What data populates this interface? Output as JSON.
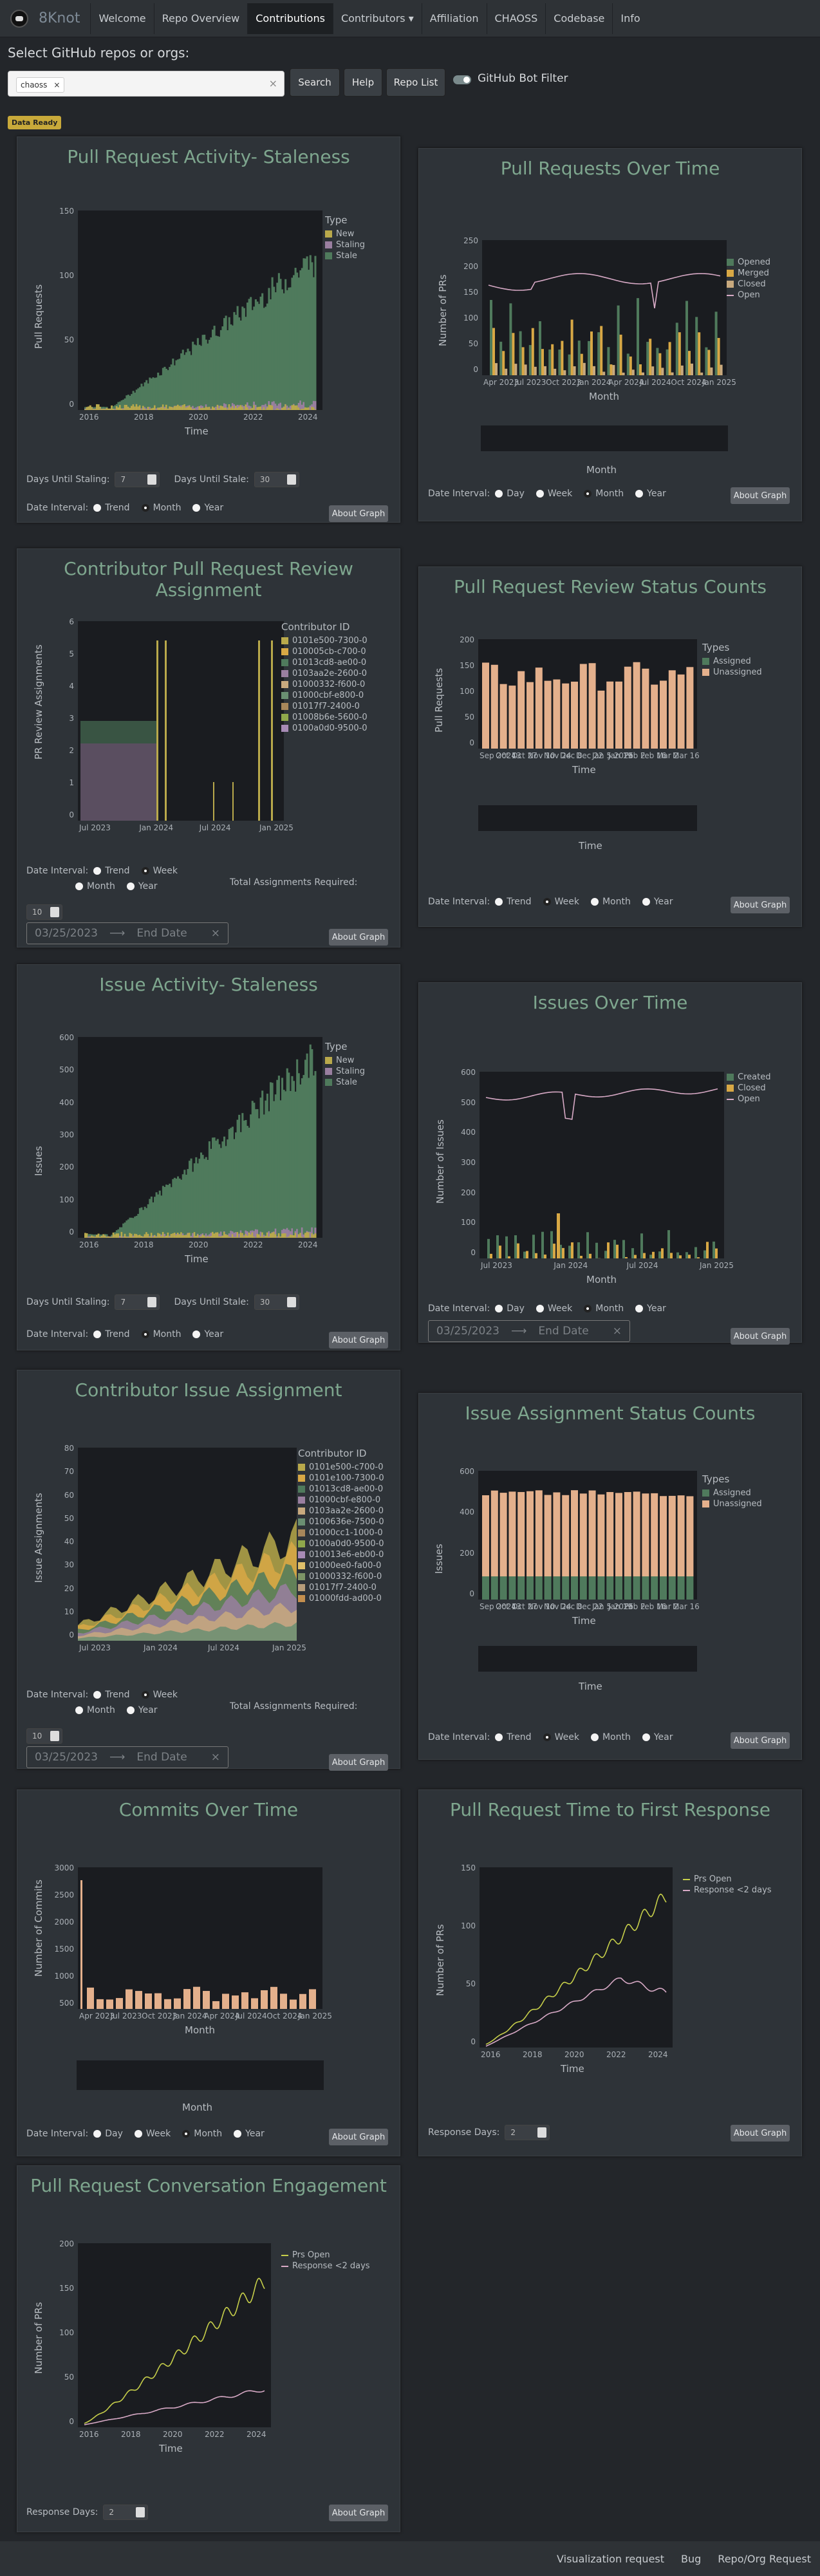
{
  "nav": {
    "brand": "8Knot",
    "items": [
      "Welcome",
      "Repo Overview",
      "Contributions",
      "Contributors ▾",
      "Affiliation",
      "CHAOSS",
      "Codebase",
      "Info"
    ],
    "active": "Contributions"
  },
  "search": {
    "label": "Select GitHub repos or orgs:",
    "chip": "chaoss",
    "search_btn": "Search",
    "help_btn": "Help",
    "repo_list_btn": "Repo List",
    "bot_filter": "GitHub Bot Filter"
  },
  "badge": "Data Ready",
  "common": {
    "about": "About Graph",
    "date_interval": "Date Interval:",
    "trend": "Trend",
    "month": "Month",
    "year": "Year",
    "week": "Week",
    "day": "Day",
    "stal": "Days Until Staling:",
    "stale": "Days Until Stale:",
    "stal_val": "7",
    "stale_val": "30",
    "types": "Types",
    "type": "Type",
    "start_date": "03/25/2023",
    "end_date": "End Date",
    "total_assign": "Total Assignments Required:",
    "total_val": "10",
    "resp_days": "Response Days:",
    "resp_val": "2",
    "contrib_id": "Contributor ID"
  },
  "cards": {
    "pr_stale": {
      "title": "Pull Request Activity- Staleness",
      "ylabel": "Pull Requests",
      "xlabel": "Time",
      "legend": [
        "New",
        "Staling",
        "Stale"
      ],
      "yticks": [
        "150",
        "100",
        "50",
        "0"
      ],
      "xticks": [
        "2016",
        "2018",
        "2020",
        "2022",
        "2024"
      ]
    },
    "pr_time": {
      "title": "Pull Requests Over Time",
      "ylabel": "Number of PRs",
      "xlabel": "Month",
      "legend": [
        "Opened",
        "Merged",
        "Closed",
        "Open"
      ],
      "yticks": [
        "250",
        "200",
        "150",
        "100",
        "50",
        "0"
      ],
      "xticks": [
        "Apr 2023",
        "Jul 2023",
        "Oct 2023",
        "Jan 2024",
        "Apr 2024",
        "Jul 2024",
        "Oct 2024",
        "Jan 2025"
      ]
    },
    "contrib_pr": {
      "title": "Contributor Pull Request Review Assignment",
      "ylabel": "PR Review Assignments",
      "legend": [
        "0101e500-7300-0",
        "010005cb-c700-0",
        "01013cd8-ae00-0",
        "0103aa2e-2600-0",
        "01000332-f600-0",
        "01000cbf-e800-0",
        "01017f7-2400-0",
        "01008b6e-5600-0",
        "0100a0d0-9500-0"
      ],
      "yticks": [
        "6",
        "5",
        "4",
        "3",
        "2",
        "1",
        "0"
      ],
      "xticks": [
        "Jul 2023",
        "Jan 2024",
        "Jul 2024",
        "Jan 2025"
      ]
    },
    "pr_review": {
      "title": "Pull Request Review Status Counts",
      "ylabel": "Pull Requests",
      "xlabel": "Time",
      "legend": [
        "Assigned",
        "Unassigned"
      ],
      "yticks": [
        "200",
        "150",
        "100",
        "50",
        "0"
      ],
      "xticks": [
        "Sep 2024",
        "Oct 13",
        "Oct 27",
        "Nov 10",
        "Nov 24",
        "Dec 8",
        "Dec 22",
        "Jan 5 2025",
        "Jan 19",
        "Feb 2",
        "Feb 16",
        "Mar 2",
        "Mar 16"
      ]
    },
    "issue_stale": {
      "title": "Issue Activity- Staleness",
      "ylabel": "Issues",
      "xlabel": "Time",
      "legend": [
        "New",
        "Staling",
        "Stale"
      ],
      "yticks": [
        "600",
        "500",
        "400",
        "300",
        "200",
        "100",
        "0"
      ],
      "xticks": [
        "2016",
        "2018",
        "2020",
        "2022",
        "2024"
      ]
    },
    "issue_time": {
      "title": "Issues Over Time",
      "ylabel": "Number of Issues",
      "xlabel": "Month",
      "legend": [
        "Created",
        "Closed",
        "Open"
      ],
      "yticks": [
        "600",
        "500",
        "400",
        "300",
        "200",
        "100",
        "0"
      ],
      "xticks": [
        "Jul 2023",
        "Jan 2024",
        "Jul 2024",
        "Jan 2025"
      ]
    },
    "contrib_issue": {
      "title": "Contributor Issue Assignment",
      "ylabel": "Issue Assignments",
      "legend": [
        "0101e500-c700-0",
        "0101e100-7300-0",
        "01013cd8-ae00-0",
        "01000cbf-e800-0",
        "0103aa2e-2600-0",
        "0100636e-7500-0",
        "01000cc1-1000-0",
        "0100a0d0-9500-0",
        "010013e6-eb00-0",
        "01000ee0-fa00-0",
        "01000332-f600-0",
        "01017f7-2400-0",
        "01000fdd-ad00-0"
      ],
      "yticks": [
        "80",
        "70",
        "60",
        "50",
        "40",
        "30",
        "20",
        "10",
        "0"
      ],
      "xticks": [
        "Jul 2023",
        "Jan 2024",
        "Jul 2024",
        "Jan 2025"
      ]
    },
    "issue_assign": {
      "title": "Issue Assignment Status Counts",
      "ylabel": "Issues",
      "xlabel": "Time",
      "legend": [
        "Assigned",
        "Unassigned"
      ],
      "yticks": [
        "600",
        "400",
        "200",
        "0"
      ],
      "xticks": [
        "Sep 2024",
        "Oct 13",
        "Oct 27",
        "Nov 10",
        "Nov 24",
        "Dec 8",
        "Dec 22",
        "Jan 5 2025",
        "Jan 19",
        "Feb 2",
        "Feb 16",
        "Mar 2",
        "Mar 16"
      ]
    },
    "commits": {
      "title": "Commits Over Time",
      "ylabel": "Number of Commits",
      "xlabel": "Month",
      "yticks": [
        "3000",
        "2500",
        "2000",
        "1500",
        "1000",
        "500"
      ],
      "xticks": [
        "Apr 2023",
        "Jul 2023",
        "Oct 2023",
        "Jan 2024",
        "Apr 2024",
        "Jul 2024",
        "Oct 2024",
        "Jan 2025"
      ]
    },
    "first_resp": {
      "title": "Pull Request Time to First Response",
      "ylabel": "Number of PRs",
      "xlabel": "Time",
      "legend": [
        "Prs Open",
        "Response <2 days"
      ],
      "yticks": [
        "150",
        "100",
        "50",
        "0"
      ],
      "xticks": [
        "2016",
        "2018",
        "2020",
        "2022",
        "2024"
      ]
    },
    "conv": {
      "title": "Pull Request Conversation Engagement",
      "ylabel": "Number of PRs",
      "xlabel": "Time",
      "legend": [
        "Prs Open",
        "Response <2 days"
      ],
      "yticks": [
        "200",
        "150",
        "100",
        "50",
        "0"
      ],
      "xticks": [
        "2016",
        "2018",
        "2020",
        "2022",
        "2024"
      ]
    }
  },
  "colors": {
    "new": "#b9a94b",
    "staling": "#9a7fa0",
    "stale": "#4f7a5c",
    "opened": "#4f7a5c",
    "merged": "#d8a845",
    "closed": "#c8a97e",
    "unassigned": "#e4b08c",
    "assigned": "#4f7a5c",
    "line_yellow": "#c7cf4a",
    "line_pink": "#d8aac6"
  },
  "footer": [
    "Visualization request",
    "Bug",
    "Repo/Org Request"
  ]
}
